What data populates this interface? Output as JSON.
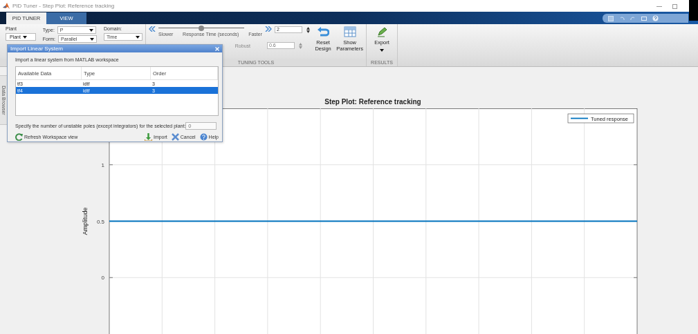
{
  "window": {
    "title": "PID Tuner - Step Plot: Reference tracking"
  },
  "tabs": [
    {
      "label": "PID TUNER",
      "selected": true
    },
    {
      "label": "VIEW",
      "selected": false
    }
  ],
  "toolstrip": {
    "plant": {
      "label": "Plant",
      "button": "Plant"
    },
    "type": {
      "label": "Type:",
      "value": "P"
    },
    "form": {
      "label": "Form:",
      "value": "Parallel"
    },
    "domain": {
      "label": "Domain:",
      "value": "Time"
    },
    "response_time": {
      "slower": "Slower",
      "label": "Response Time (seconds)",
      "faster": "Faster",
      "level": 0.5,
      "value": "2"
    },
    "robustness": {
      "label": "Robust",
      "value": "0.6",
      "disabled": true
    },
    "buttons": [
      {
        "label": "Reset Design",
        "kind": "reset"
      },
      {
        "label": "Show Parameters",
        "kind": "table"
      }
    ],
    "tuning_section": "TUNING TOOLS",
    "export": {
      "label": "Export"
    },
    "results_section": "RESULTS"
  },
  "side_tab": "Data Browser",
  "dialog": {
    "title": "Import Linear System",
    "intro": "Import a linear system from MATLAB workspace",
    "columns": [
      "Available Data",
      "Type",
      "Order"
    ],
    "rows": [
      {
        "cells": [
          "tf3",
          "idtf",
          "3"
        ],
        "selected": false
      },
      {
        "cells": [
          "tf4",
          "idtf",
          "3"
        ],
        "selected": true
      }
    ],
    "poles_label": "Specify the number of unstable poles (except integrators) for the selected plant:",
    "poles_value": "0",
    "buttons": [
      {
        "label": "Refresh Workspace view",
        "kind": "refresh"
      },
      {
        "label": "Import",
        "kind": "import"
      },
      {
        "label": "Cancel",
        "kind": "cancel"
      },
      {
        "label": "Help",
        "kind": "help"
      }
    ]
  },
  "plot": {
    "chart_data": {
      "type": "line",
      "title": "Step Plot: Reference tracking",
      "ylabel": "Amplitude",
      "ylim": [
        -0.5,
        1.5
      ],
      "yticks": [
        0,
        0.5,
        1
      ],
      "grid": true,
      "series": [
        {
          "name": "Tuned response",
          "color": "#0072bd",
          "values": [
            0.5,
            0.5,
            0.5,
            0.5,
            0.5,
            0.5,
            0.5,
            0.5,
            0.5,
            0.5,
            0.5
          ]
        }
      ]
    }
  }
}
